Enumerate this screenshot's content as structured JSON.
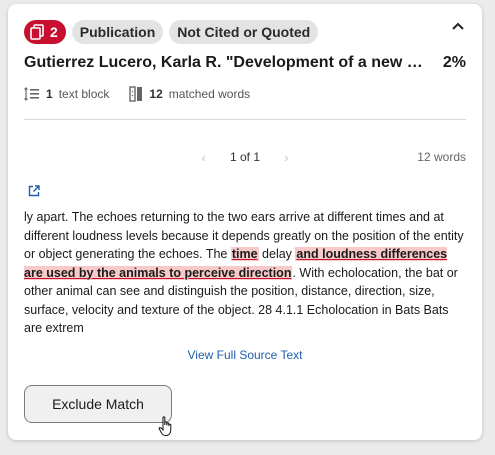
{
  "match_card": {
    "match_count": "2",
    "tags": [
      "Publication",
      "Not Cited or Quoted"
    ],
    "title": "Gutierrez Lucero, Karla R. \"Development of a new method for echolocation\"",
    "percent": "2%",
    "text_blocks_value": "1",
    "text_blocks_label": "text block",
    "matched_words_value": "12",
    "matched_words_label": "matched words",
    "pager_label": "1 of 1",
    "word_count": "12 words",
    "excerpt": {
      "before": "ly apart. The echoes returning to the two ears arrive at different times and at different loudness levels because it depends greatly on the position of the entity or object generating the echoes. The ",
      "hl1": "time",
      "mid": " delay ",
      "hl2": "and loudness differences are used by the animals to perceive direction",
      "after": ". With echolocation, the bat or other animal can see and distinguish the position, distance, direction, size, surface, velocity and texture of the object. 28 4.1.1 Echolocation in Bats Bats are extrem"
    },
    "view_full_label": "View Full Source Text",
    "exclude_label": "Exclude Match"
  },
  "colors": {
    "accent_red": "#c8102e",
    "highlight": "#f7c9c9",
    "link_blue": "#1f5fb0"
  },
  "icons": [
    "copy-icon",
    "chevron-up-icon",
    "text-block-icon",
    "matched-words-icon",
    "chevron-left-icon",
    "chevron-right-icon",
    "external-link-icon",
    "hand-cursor-icon"
  ]
}
